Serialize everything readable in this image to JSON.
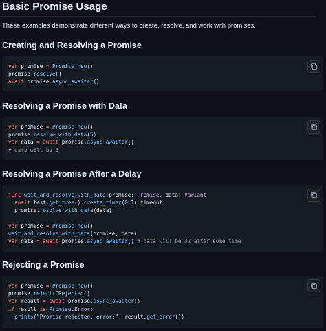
{
  "title": "Basic Promise Usage",
  "intro": "These examples demonstrate different ways to create, resolve, and work with promises.",
  "icons": {
    "copy": "copy-icon"
  },
  "sections": [
    {
      "heading": "Creating and Resolving a Promise",
      "lines": [
        [
          [
            "kw",
            "var"
          ],
          [
            "",
            "  promise "
          ],
          [
            "kw",
            "="
          ],
          [
            "",
            ""
          ],
          [
            "fn",
            " Promise"
          ],
          [
            "",
            "."
          ],
          [
            "fn",
            "new"
          ],
          [
            "",
            "()"
          ]
        ],
        [
          [
            "",
            "promise."
          ],
          [
            "fn",
            "resolve"
          ],
          [
            "",
            "()"
          ]
        ],
        [
          [
            "kw",
            "await"
          ],
          [
            "",
            ""
          ],
          [
            "",
            "  promise."
          ],
          [
            "fn",
            "async_awaiter"
          ],
          [
            "",
            "()"
          ]
        ]
      ]
    },
    {
      "heading": "Resolving a Promise with Data",
      "lines": [
        [
          [
            "kw",
            "var"
          ],
          [
            "",
            "  promise "
          ],
          [
            "kw",
            "="
          ],
          [
            "fn",
            " Promise"
          ],
          [
            "",
            "."
          ],
          [
            "fn",
            "new"
          ],
          [
            "",
            "()"
          ]
        ],
        [
          [
            "",
            "promise."
          ],
          [
            "fn",
            "resolve_with_data"
          ],
          [
            "",
            "("
          ],
          [
            "nm",
            "5"
          ],
          [
            "",
            ")"
          ]
        ],
        [
          [
            "kw",
            "var"
          ],
          [
            "",
            "  data "
          ],
          [
            "kw",
            "="
          ],
          [
            "kw",
            " await"
          ],
          [
            "",
            "  promise."
          ],
          [
            "fn",
            "async_awaiter"
          ],
          [
            "",
            "()"
          ]
        ],
        [
          [
            "cm",
            "# data will be 5"
          ]
        ]
      ]
    },
    {
      "heading": "Resolving a Promise After a Delay",
      "lines": [
        [
          [
            "kw",
            "func"
          ],
          [
            "",
            ""
          ],
          [
            "fn",
            " wait_and_resolve_with_data"
          ],
          [
            "",
            "(promise: "
          ],
          [
            "ty",
            "Promise"
          ],
          [
            "",
            ", data: "
          ],
          [
            "ty",
            "Variant"
          ],
          [
            "",
            ")"
          ]
        ],
        [
          [
            "",
            "    "
          ],
          [
            "kw",
            "await"
          ],
          [
            "",
            "  test."
          ],
          [
            "fn",
            "get_tree"
          ],
          [
            "",
            "()."
          ],
          [
            "fn",
            "create_timer"
          ],
          [
            "",
            "("
          ],
          [
            "nm",
            "0.1"
          ],
          [
            "",
            ").timeout"
          ]
        ],
        [
          [
            "",
            "    promise."
          ],
          [
            "fn",
            "resolve_with_data"
          ],
          [
            "",
            "(data)"
          ]
        ],
        [
          [
            "",
            ""
          ]
        ],
        [
          [
            "kw",
            "var"
          ],
          [
            "",
            "  promise "
          ],
          [
            "kw",
            "="
          ],
          [
            "fn",
            " Promise"
          ],
          [
            "",
            "."
          ],
          [
            "fn",
            "new"
          ],
          [
            "",
            "()"
          ]
        ],
        [
          [
            "fn",
            "wait_and_resolve_with_data"
          ],
          [
            "",
            "(promise, data)"
          ]
        ],
        [
          [
            "kw",
            "var"
          ],
          [
            "",
            "  data "
          ],
          [
            "kw",
            "="
          ],
          [
            "kw",
            " await"
          ],
          [
            "",
            "  promise."
          ],
          [
            "fn",
            "async_awaiter"
          ],
          [
            "",
            "()"
          ],
          [
            "cm",
            " # data will be 32 after some time"
          ]
        ]
      ]
    },
    {
      "heading": "Rejecting a Promise",
      "lines": [
        [
          [
            "kw",
            "var"
          ],
          [
            "",
            "  promise "
          ],
          [
            "kw",
            "="
          ],
          [
            "fn",
            " Promise"
          ],
          [
            "",
            "."
          ],
          [
            "fn",
            "new"
          ],
          [
            "",
            "()"
          ]
        ],
        [
          [
            "",
            "promise."
          ],
          [
            "fn",
            "reject"
          ],
          [
            "",
            "("
          ],
          [
            "st",
            "\"Rejected\""
          ],
          [
            "",
            ")"
          ]
        ],
        [
          [
            "kw",
            "var"
          ],
          [
            "",
            "  result "
          ],
          [
            "kw",
            "="
          ],
          [
            "kw",
            " await"
          ],
          [
            "",
            "  promise."
          ],
          [
            "fn",
            "async_awaiter"
          ],
          [
            "",
            "()"
          ]
        ],
        [
          [
            "kw",
            "if"
          ],
          [
            "",
            "  result "
          ],
          [
            "kw",
            "is"
          ],
          [
            "fn",
            " Promise"
          ],
          [
            "",
            "."
          ],
          [
            "ty",
            "Error"
          ],
          [
            "",
            ":"
          ]
        ],
        [
          [
            "",
            "    "
          ],
          [
            "fn",
            "prints"
          ],
          [
            "",
            "("
          ],
          [
            "st",
            "\"Promise rejected, error:\""
          ],
          [
            "",
            ", result."
          ],
          [
            "fn",
            "get_error"
          ],
          [
            "",
            "())"
          ]
        ]
      ]
    }
  ]
}
